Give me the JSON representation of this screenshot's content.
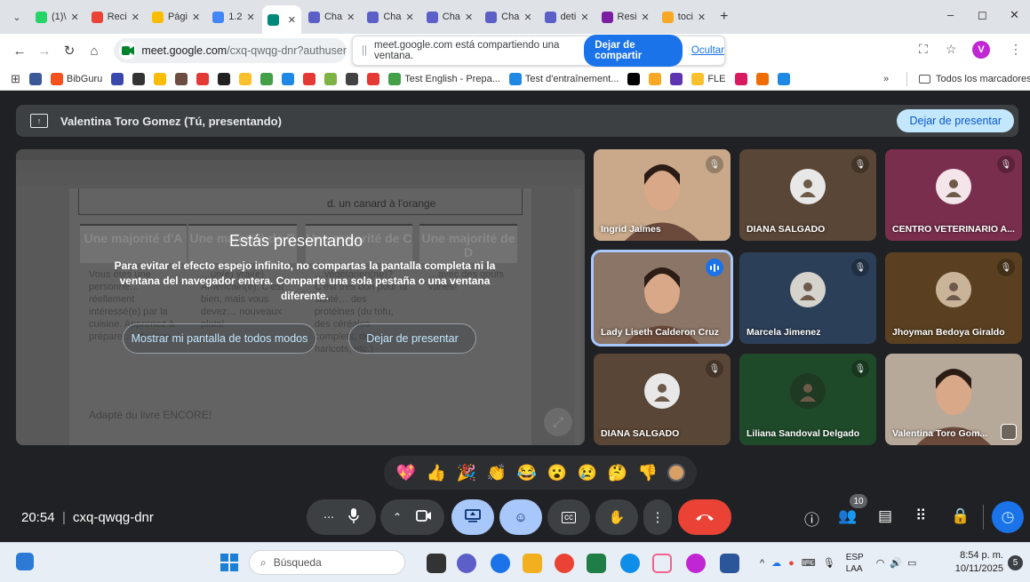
{
  "browser": {
    "tabs": [
      {
        "label": "(1)\\",
        "color": "#25d366"
      },
      {
        "label": "Reci",
        "color": "#ea4335"
      },
      {
        "label": "Pági",
        "color": "#fbbc04"
      },
      {
        "label": "1.2",
        "color": "#4285f4"
      },
      {
        "label": "",
        "color": "#00897b"
      },
      {
        "label": "Cha",
        "color": "#5b5fc7"
      },
      {
        "label": "Cha",
        "color": "#5b5fc7"
      },
      {
        "label": "Cha",
        "color": "#5b5fc7"
      },
      {
        "label": "Cha",
        "color": "#5b5fc7"
      },
      {
        "label": "deti",
        "color": "#5b5fc7"
      },
      {
        "label": "Resi",
        "color": "#7b1fa2"
      },
      {
        "label": "toci",
        "color": "#f9a825"
      }
    ],
    "new_tab": "+",
    "window_controls": {
      "minimize": "–",
      "restore": "◻",
      "close": "✕"
    },
    "url_host": "meet.google.com",
    "url_path": "/cxq-qwqg-dnr?authuser",
    "share_banner": {
      "text": "meet.google.com está compartiendo una ventana.",
      "stop_label": "Dejar de compartir",
      "hide_label": "Ocultar"
    },
    "profile_initial": "V"
  },
  "bookmarks": {
    "items": [
      {
        "label": "",
        "color": "#3b5998"
      },
      {
        "label": "BibGuru",
        "color": "#f4511e"
      },
      {
        "label": "",
        "color": "#3949ab"
      },
      {
        "label": "",
        "color": "#333333"
      },
      {
        "label": "",
        "color": "#fbbc04"
      },
      {
        "label": "",
        "color": "#6d4c41"
      },
      {
        "label": "",
        "color": "#e53935"
      },
      {
        "label": "",
        "color": "#212121"
      },
      {
        "label": "",
        "color": "#fbc02d"
      },
      {
        "label": "",
        "color": "#43a047"
      },
      {
        "label": "",
        "color": "#1e88e5"
      },
      {
        "label": "",
        "color": "#e53935"
      },
      {
        "label": "",
        "color": "#7cb342"
      },
      {
        "label": "",
        "color": "#424242"
      },
      {
        "label": "",
        "color": "#e53935"
      },
      {
        "label": "Test English - Prepa...",
        "color": "#43a047"
      },
      {
        "label": "Test d'entraînement...",
        "color": "#1e88e5"
      },
      {
        "label": "",
        "color": "#000000"
      },
      {
        "label": "",
        "color": "#f9a825"
      },
      {
        "label": "",
        "color": "#5e35b1"
      },
      {
        "label": "FLE",
        "color": "#fbc02d"
      },
      {
        "label": "",
        "color": "#d81b60"
      },
      {
        "label": "",
        "color": "#ef6c00"
      },
      {
        "label": "",
        "color": "#1e88e5"
      }
    ],
    "overflow": "»",
    "all_bookmarks": "Todos los marcadores"
  },
  "meet": {
    "presenter_bar": {
      "presenter": "Valentina Toro Gomez (Tú, presentando)",
      "stop_label": "Dejar de presentar"
    },
    "shared_doc": {
      "option_d": "d. un canard à l'orange",
      "columns": [
        {
          "head": "Une majorité d'A",
          "text": "Vous êtes une personne… réellement intéressé(e) par la cuisine. Apprenez à préparer… de bien…"
        },
        {
          "head": "Une majorité de B",
          "text": "…un(e) vrai(e) Américain(e). C'est bien, mais vous devez… nouveaux plats!"
        },
        {
          "head": "Une majorité de C",
          "text": "…végétarien(ne)? C'est très bon pour la santé… des protéines (du tofu, des céréales complets, des haricots, etc.)"
        },
        {
          "head": "Une majorité de D",
          "text": "…avec des goûts variés!"
        }
      ],
      "source": "Adapté du livre ENCORE!"
    },
    "overlay": {
      "title": "Estás presentando",
      "message": "Para evitar el efecto espejo infinito, no compartas la pantalla completa ni la ventana del navegador entera. Comparte una sola pestaña o una ventana diferente.",
      "show_anyway": "Mostrar mi pantalla de todos modos",
      "stop": "Dejar de presentar"
    },
    "participants": [
      {
        "name": "Ingrid Jaimes",
        "muted": true,
        "bg": "#c9a98a"
      },
      {
        "name": "DIANA SALGADO",
        "muted": true,
        "bg": "#5a4636",
        "avatar_bg": "#e8e8e8"
      },
      {
        "name": "CENTRO VETERINARIO A...",
        "muted": true,
        "bg": "#7a2e4e",
        "avatar_bg": "#f3e5ea"
      },
      {
        "name": "Lady Liseth Calderon Cruz",
        "muted": false,
        "speaking": true,
        "bg": "#8a7566"
      },
      {
        "name": "Marcela Jimenez",
        "muted": true,
        "bg": "#2c3f58",
        "avatar_bg": "#d6d2cc"
      },
      {
        "name": "Jhoyman Bedoya Giraldo",
        "muted": true,
        "bg": "#5a4020",
        "avatar_bg": "#c9b49a"
      },
      {
        "name": "DIANA SALGADO",
        "muted": true,
        "bg": "#5a4636",
        "avatar_bg": "#e8e8e8"
      },
      {
        "name": "Liliana Sandoval Delgado",
        "muted": true,
        "bg": "#1f4a2a",
        "avatar_bg": "#1e3a22"
      },
      {
        "name": "Valentina Toro Gom...",
        "muted": false,
        "bg": "#b7a99a"
      }
    ],
    "reactions": [
      "💖",
      "👍",
      "🎉",
      "👏",
      "😂",
      "😮",
      "😢",
      "🤔",
      "👎"
    ],
    "meeting_time": "20:54",
    "separator": "|",
    "meeting_code": "cxq-qwqg-dnr",
    "people_count": "10"
  },
  "taskbar": {
    "search_placeholder": "Búsqueda",
    "language": "ESP",
    "layout": "LAA",
    "time": "8:54 p. m.",
    "date": "10/11/2025",
    "notifications": "5"
  }
}
